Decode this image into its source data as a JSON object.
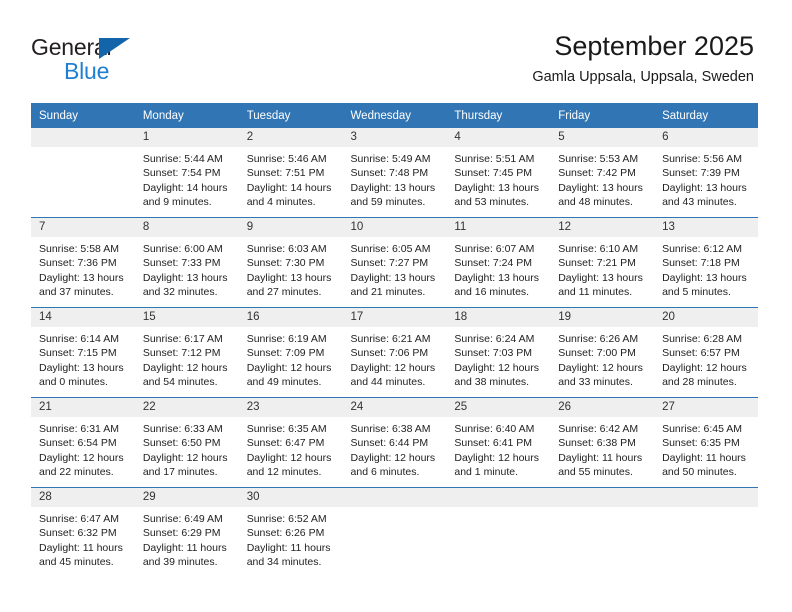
{
  "brand": {
    "name_part1": "General",
    "name_part2": "Blue",
    "triangle_color": "#1464aa",
    "blue_color": "#1f7fd0"
  },
  "header": {
    "title": "September 2025",
    "subtitle": "Gamla Uppsala, Uppsala, Sweden"
  },
  "colors": {
    "header_row": "#3175b4",
    "daynum_band": "#efefef",
    "week_separator": "#3175b4",
    "text": "#222222"
  },
  "weekday_headers": [
    "Sunday",
    "Monday",
    "Tuesday",
    "Wednesday",
    "Thursday",
    "Friday",
    "Saturday"
  ],
  "weeks": [
    [
      {
        "day": "",
        "empty": true,
        "sunrise": "",
        "sunset": "",
        "daylight_line1": "",
        "daylight_line2": ""
      },
      {
        "day": "1",
        "empty": false,
        "sunrise": "Sunrise: 5:44 AM",
        "sunset": "Sunset: 7:54 PM",
        "daylight_line1": "Daylight: 14 hours",
        "daylight_line2": "and 9 minutes."
      },
      {
        "day": "2",
        "empty": false,
        "sunrise": "Sunrise: 5:46 AM",
        "sunset": "Sunset: 7:51 PM",
        "daylight_line1": "Daylight: 14 hours",
        "daylight_line2": "and 4 minutes."
      },
      {
        "day": "3",
        "empty": false,
        "sunrise": "Sunrise: 5:49 AM",
        "sunset": "Sunset: 7:48 PM",
        "daylight_line1": "Daylight: 13 hours",
        "daylight_line2": "and 59 minutes."
      },
      {
        "day": "4",
        "empty": false,
        "sunrise": "Sunrise: 5:51 AM",
        "sunset": "Sunset: 7:45 PM",
        "daylight_line1": "Daylight: 13 hours",
        "daylight_line2": "and 53 minutes."
      },
      {
        "day": "5",
        "empty": false,
        "sunrise": "Sunrise: 5:53 AM",
        "sunset": "Sunset: 7:42 PM",
        "daylight_line1": "Daylight: 13 hours",
        "daylight_line2": "and 48 minutes."
      },
      {
        "day": "6",
        "empty": false,
        "sunrise": "Sunrise: 5:56 AM",
        "sunset": "Sunset: 7:39 PM",
        "daylight_line1": "Daylight: 13 hours",
        "daylight_line2": "and 43 minutes."
      }
    ],
    [
      {
        "day": "7",
        "empty": false,
        "sunrise": "Sunrise: 5:58 AM",
        "sunset": "Sunset: 7:36 PM",
        "daylight_line1": "Daylight: 13 hours",
        "daylight_line2": "and 37 minutes."
      },
      {
        "day": "8",
        "empty": false,
        "sunrise": "Sunrise: 6:00 AM",
        "sunset": "Sunset: 7:33 PM",
        "daylight_line1": "Daylight: 13 hours",
        "daylight_line2": "and 32 minutes."
      },
      {
        "day": "9",
        "empty": false,
        "sunrise": "Sunrise: 6:03 AM",
        "sunset": "Sunset: 7:30 PM",
        "daylight_line1": "Daylight: 13 hours",
        "daylight_line2": "and 27 minutes."
      },
      {
        "day": "10",
        "empty": false,
        "sunrise": "Sunrise: 6:05 AM",
        "sunset": "Sunset: 7:27 PM",
        "daylight_line1": "Daylight: 13 hours",
        "daylight_line2": "and 21 minutes."
      },
      {
        "day": "11",
        "empty": false,
        "sunrise": "Sunrise: 6:07 AM",
        "sunset": "Sunset: 7:24 PM",
        "daylight_line1": "Daylight: 13 hours",
        "daylight_line2": "and 16 minutes."
      },
      {
        "day": "12",
        "empty": false,
        "sunrise": "Sunrise: 6:10 AM",
        "sunset": "Sunset: 7:21 PM",
        "daylight_line1": "Daylight: 13 hours",
        "daylight_line2": "and 11 minutes."
      },
      {
        "day": "13",
        "empty": false,
        "sunrise": "Sunrise: 6:12 AM",
        "sunset": "Sunset: 7:18 PM",
        "daylight_line1": "Daylight: 13 hours",
        "daylight_line2": "and 5 minutes."
      }
    ],
    [
      {
        "day": "14",
        "empty": false,
        "sunrise": "Sunrise: 6:14 AM",
        "sunset": "Sunset: 7:15 PM",
        "daylight_line1": "Daylight: 13 hours",
        "daylight_line2": "and 0 minutes."
      },
      {
        "day": "15",
        "empty": false,
        "sunrise": "Sunrise: 6:17 AM",
        "sunset": "Sunset: 7:12 PM",
        "daylight_line1": "Daylight: 12 hours",
        "daylight_line2": "and 54 minutes."
      },
      {
        "day": "16",
        "empty": false,
        "sunrise": "Sunrise: 6:19 AM",
        "sunset": "Sunset: 7:09 PM",
        "daylight_line1": "Daylight: 12 hours",
        "daylight_line2": "and 49 minutes."
      },
      {
        "day": "17",
        "empty": false,
        "sunrise": "Sunrise: 6:21 AM",
        "sunset": "Sunset: 7:06 PM",
        "daylight_line1": "Daylight: 12 hours",
        "daylight_line2": "and 44 minutes."
      },
      {
        "day": "18",
        "empty": false,
        "sunrise": "Sunrise: 6:24 AM",
        "sunset": "Sunset: 7:03 PM",
        "daylight_line1": "Daylight: 12 hours",
        "daylight_line2": "and 38 minutes."
      },
      {
        "day": "19",
        "empty": false,
        "sunrise": "Sunrise: 6:26 AM",
        "sunset": "Sunset: 7:00 PM",
        "daylight_line1": "Daylight: 12 hours",
        "daylight_line2": "and 33 minutes."
      },
      {
        "day": "20",
        "empty": false,
        "sunrise": "Sunrise: 6:28 AM",
        "sunset": "Sunset: 6:57 PM",
        "daylight_line1": "Daylight: 12 hours",
        "daylight_line2": "and 28 minutes."
      }
    ],
    [
      {
        "day": "21",
        "empty": false,
        "sunrise": "Sunrise: 6:31 AM",
        "sunset": "Sunset: 6:54 PM",
        "daylight_line1": "Daylight: 12 hours",
        "daylight_line2": "and 22 minutes."
      },
      {
        "day": "22",
        "empty": false,
        "sunrise": "Sunrise: 6:33 AM",
        "sunset": "Sunset: 6:50 PM",
        "daylight_line1": "Daylight: 12 hours",
        "daylight_line2": "and 17 minutes."
      },
      {
        "day": "23",
        "empty": false,
        "sunrise": "Sunrise: 6:35 AM",
        "sunset": "Sunset: 6:47 PM",
        "daylight_line1": "Daylight: 12 hours",
        "daylight_line2": "and 12 minutes."
      },
      {
        "day": "24",
        "empty": false,
        "sunrise": "Sunrise: 6:38 AM",
        "sunset": "Sunset: 6:44 PM",
        "daylight_line1": "Daylight: 12 hours",
        "daylight_line2": "and 6 minutes."
      },
      {
        "day": "25",
        "empty": false,
        "sunrise": "Sunrise: 6:40 AM",
        "sunset": "Sunset: 6:41 PM",
        "daylight_line1": "Daylight: 12 hours",
        "daylight_line2": "and 1 minute."
      },
      {
        "day": "26",
        "empty": false,
        "sunrise": "Sunrise: 6:42 AM",
        "sunset": "Sunset: 6:38 PM",
        "daylight_line1": "Daylight: 11 hours",
        "daylight_line2": "and 55 minutes."
      },
      {
        "day": "27",
        "empty": false,
        "sunrise": "Sunrise: 6:45 AM",
        "sunset": "Sunset: 6:35 PM",
        "daylight_line1": "Daylight: 11 hours",
        "daylight_line2": "and 50 minutes."
      }
    ],
    [
      {
        "day": "28",
        "empty": false,
        "sunrise": "Sunrise: 6:47 AM",
        "sunset": "Sunset: 6:32 PM",
        "daylight_line1": "Daylight: 11 hours",
        "daylight_line2": "and 45 minutes."
      },
      {
        "day": "29",
        "empty": false,
        "sunrise": "Sunrise: 6:49 AM",
        "sunset": "Sunset: 6:29 PM",
        "daylight_line1": "Daylight: 11 hours",
        "daylight_line2": "and 39 minutes."
      },
      {
        "day": "30",
        "empty": false,
        "sunrise": "Sunrise: 6:52 AM",
        "sunset": "Sunset: 6:26 PM",
        "daylight_line1": "Daylight: 11 hours",
        "daylight_line2": "and 34 minutes."
      },
      {
        "day": "",
        "empty": true,
        "sunrise": "",
        "sunset": "",
        "daylight_line1": "",
        "daylight_line2": ""
      },
      {
        "day": "",
        "empty": true,
        "sunrise": "",
        "sunset": "",
        "daylight_line1": "",
        "daylight_line2": ""
      },
      {
        "day": "",
        "empty": true,
        "sunrise": "",
        "sunset": "",
        "daylight_line1": "",
        "daylight_line2": ""
      },
      {
        "day": "",
        "empty": true,
        "sunrise": "",
        "sunset": "",
        "daylight_line1": "",
        "daylight_line2": ""
      }
    ]
  ]
}
